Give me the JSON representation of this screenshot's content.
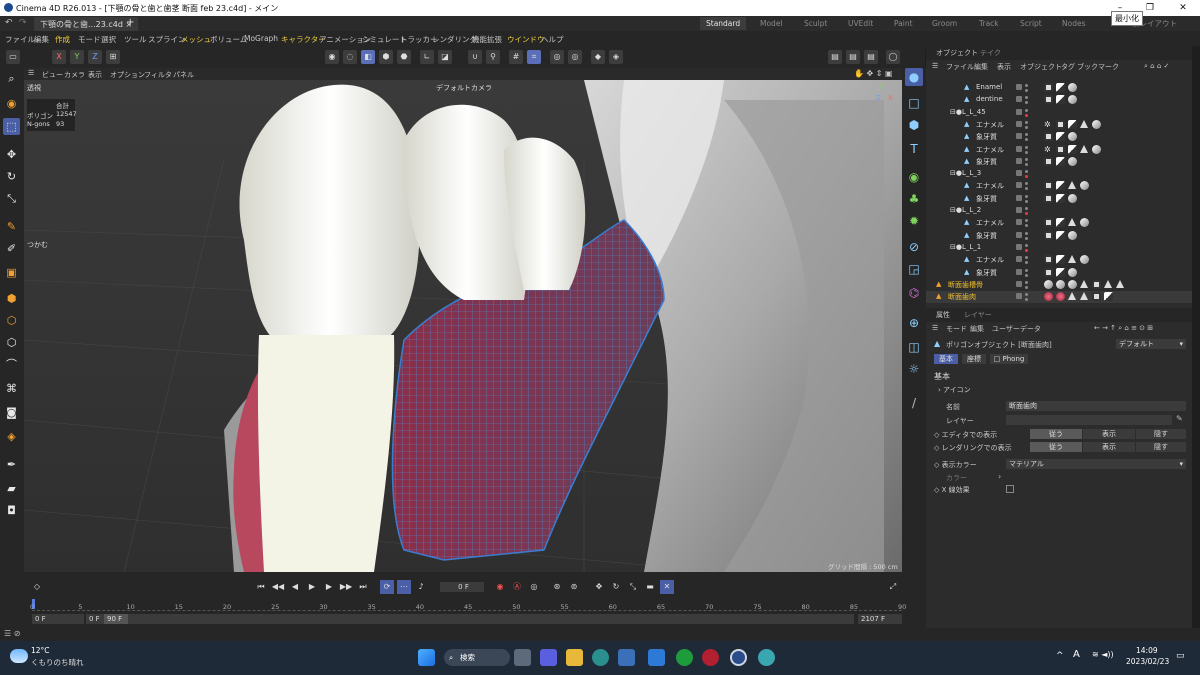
{
  "window": {
    "title": "Cinema 4D R26.013 - [下顎の骨と歯と歯茎 断面 feb 23.c4d] - メイン",
    "tooltip": "最小化",
    "controls": [
      "–",
      "❐",
      "✕"
    ]
  },
  "tabs": {
    "doc": "下顎の骨と歯...23.c4d",
    "add": "+",
    "layouts": [
      "Standard",
      "Model",
      "Sculpt",
      "UVEdit",
      "Paint",
      "Groom",
      "Track",
      "Script",
      "Nodes"
    ],
    "new_layout": "新レイアウト"
  },
  "menu": {
    "items": [
      "ファイル",
      "編集",
      "作成",
      "モード",
      "選択",
      "ツール",
      "スプライン",
      "メッシュ",
      "ボリューム",
      "MoGraph",
      "キャラクター",
      "アニメーション",
      "シミュレート",
      "トラッカー",
      "レンダリング",
      "機能拡張",
      "ウインドウ",
      "ヘルプ"
    ]
  },
  "toolbar": {
    "axes": [
      "X",
      "Y",
      "Z"
    ]
  },
  "viewport": {
    "menu": [
      "ビュー",
      "カメラ",
      "表示",
      "オプション",
      "フィルタ",
      "パネル"
    ],
    "mode_label": "透視",
    "camera_label": "デフォルトカメラ",
    "stats": {
      "header": "合計",
      "rows": [
        {
          "k": "ポリゴン",
          "v": "12547"
        },
        {
          "k": "N-gons",
          "v": "93"
        }
      ]
    },
    "grab_label": "つかむ",
    "grid_label": "グリッド間隔 : 500 cm",
    "axis": {
      "y": "Y",
      "x": "X",
      "z": "Z"
    }
  },
  "object_manager": {
    "tabs": [
      "オブジェクト",
      "テイク"
    ],
    "menu": [
      "ファイル",
      "編集",
      "表示",
      "オブジェクト",
      "タグ",
      "ブックマーク"
    ],
    "rows": [
      {
        "name": "Enamel",
        "indent": 2,
        "tags": [
          "q",
          "t",
          "c"
        ]
      },
      {
        "name": "dentine",
        "indent": 2,
        "tags": [
          "q",
          "t",
          "c"
        ]
      },
      {
        "name": "L_L_45",
        "indent": 1,
        "tags": []
      },
      {
        "name": "エナメル",
        "indent": 2,
        "tags": [
          "g",
          "q",
          "t",
          "a",
          "c"
        ]
      },
      {
        "name": "象牙質",
        "indent": 2,
        "tags": [
          "q",
          "t",
          "c"
        ]
      },
      {
        "name": "エナメル",
        "indent": 2,
        "tags": [
          "g",
          "q",
          "t",
          "a",
          "c"
        ]
      },
      {
        "name": "象牙質",
        "indent": 2,
        "tags": [
          "q",
          "t",
          "c"
        ]
      },
      {
        "name": "L_L_3",
        "indent": 1,
        "tags": []
      },
      {
        "name": "エナメル",
        "indent": 2,
        "tags": [
          "q",
          "t",
          "a",
          "c"
        ]
      },
      {
        "name": "象牙質",
        "indent": 2,
        "tags": [
          "q",
          "t",
          "c"
        ]
      },
      {
        "name": "L_L_2",
        "indent": 1,
        "tags": []
      },
      {
        "name": "エナメル",
        "indent": 2,
        "tags": [
          "q",
          "t",
          "a",
          "c"
        ]
      },
      {
        "name": "象牙質",
        "indent": 2,
        "tags": [
          "q",
          "t",
          "c"
        ]
      },
      {
        "name": "L_L_1",
        "indent": 1,
        "tags": []
      },
      {
        "name": "エナメル",
        "indent": 2,
        "tags": [
          "q",
          "t",
          "a",
          "c"
        ]
      },
      {
        "name": "象牙質",
        "indent": 2,
        "tags": [
          "q",
          "t",
          "c"
        ]
      },
      {
        "name": "断面歯槽骨",
        "indent": 0,
        "tags": [
          "c",
          "c",
          "c",
          "a",
          "q",
          "a",
          "a"
        ]
      },
      {
        "name": "断面歯肉",
        "indent": 0,
        "tags": [
          "c",
          "c",
          "a",
          "a",
          "q",
          "t"
        ],
        "selected": true
      }
    ]
  },
  "attributes": {
    "tabs": [
      "属性",
      "レイヤー"
    ],
    "menu": [
      "モード",
      "編集",
      "ユーザーデータ"
    ],
    "object_type": "ポリゴンオブジェクト [断面歯肉]",
    "preset": "デフォルト",
    "subtabs": [
      "基本",
      "座標",
      "Phong"
    ],
    "section": "基本",
    "icon_row": "アイコン",
    "fields": {
      "name_label": "名前",
      "name_value": "断面歯肉",
      "layer_label": "レイヤー",
      "editor_label": "エディタでの表示",
      "render_label": "レンダリングでの表示",
      "options": [
        "従う",
        "表示",
        "隠す"
      ],
      "color_label": "表示カラー",
      "color_value": "マテリアル",
      "color_sub": "カラー",
      "xray_label": "X 線効果"
    }
  },
  "timeline": {
    "frame_field": "0 F",
    "ticks": [
      "0",
      "5",
      "10",
      "15",
      "20",
      "25",
      "30",
      "35",
      "40",
      "45",
      "50",
      "55",
      "60",
      "65",
      "70",
      "75",
      "80",
      "85",
      "90"
    ],
    "start": "0 F",
    "range_start": "0 F",
    "range_end": "90 F",
    "end": "2107 F"
  },
  "taskbar": {
    "weather_temp": "12°C",
    "weather_text": "くもりのち晴れ",
    "search": "検索",
    "time": "14:09",
    "date": "2023/02/23",
    "ime": "A"
  }
}
